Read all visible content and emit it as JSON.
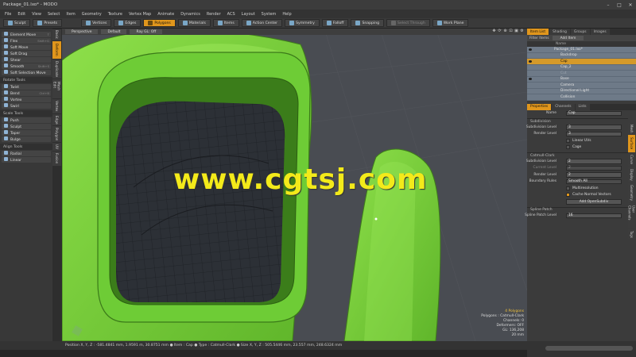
{
  "title": "Package_01.lxo* - MODO",
  "window_controls": [
    "–",
    "□",
    "✕"
  ],
  "menu": [
    "File",
    "Edit",
    "View",
    "Select",
    "Item",
    "Geometry",
    "Texture",
    "Vertex Map",
    "Animate",
    "Dynamics",
    "Render",
    "ACS",
    "Layout",
    "System",
    "Help"
  ],
  "toolbar": {
    "sculpt": "Sculpt",
    "presets": "Presets",
    "vertices": "Vertices",
    "edges": "Edges",
    "polygons": "Polygons",
    "materials": "Materials",
    "items": "Items",
    "action_center": "Action Center",
    "symmetry": "Symmetry",
    "falloff": "Falloff",
    "snapping": "Snapping",
    "select_through": "Select Through",
    "work_plane": "Work Plane"
  },
  "left_panel": {
    "group1": [
      {
        "label": "Element Move",
        "key": "T"
      },
      {
        "label": "Flex",
        "key": "Shift+G"
      },
      {
        "label": "Soft Move",
        "key": ""
      },
      {
        "label": "Soft Drag",
        "key": ""
      },
      {
        "label": "Shear",
        "key": ""
      },
      {
        "label": "Smooth",
        "key": "Shift+S"
      },
      {
        "label": "Soft Selection Move",
        "key": ""
      }
    ],
    "rotate_header": "Rotate Tools",
    "group2": [
      {
        "label": "Twist",
        "key": ""
      },
      {
        "label": "Bend",
        "key": "Ctrl+B"
      },
      {
        "label": "Vortex",
        "key": ""
      },
      {
        "label": "Swirl",
        "key": ""
      }
    ],
    "scale_header": "Scale Tools",
    "group3": [
      {
        "label": "Push",
        "key": ""
      },
      {
        "label": "Sculpt",
        "key": ""
      },
      {
        "label": "Taper",
        "key": ""
      },
      {
        "label": "Bulge",
        "key": ""
      }
    ],
    "align_header": "Align Tools",
    "group4": [
      {
        "label": "Radial",
        "key": ""
      },
      {
        "label": "Linear",
        "key": ""
      }
    ]
  },
  "vertical_tabs": [
    "Basic",
    "Deform",
    "Duplicate",
    "Mesh Edit",
    "Vertex",
    "Edge",
    "Polygon",
    "UV",
    "Fusion"
  ],
  "viewport": {
    "view_mode": "Perspective",
    "shading": "Default",
    "ray_gl": "Ray GL: Off",
    "watermark": "www.cgtsj.com",
    "info": [
      {
        "text": "4 Polygons",
        "highlight": true
      },
      {
        "text": "Polygons : Catmull-Clark",
        "highlight": false
      },
      {
        "text": "Channels: 0",
        "highlight": false
      },
      {
        "text": "Deformers: OFF",
        "highlight": false
      },
      {
        "text": "GL: 136,208",
        "highlight": false
      },
      {
        "text": "20 mm",
        "highlight": false
      }
    ]
  },
  "status": "Position X, Y, Z : -581.4841 mm, 1.9591 m, 30.8751 mm ● Item : Cap ● Type : Catmull-Clark ● Size X, Y, Z : 505.5446 mm, 23.557 mm, 248.6324 mm",
  "right_panel": {
    "top_tabs": [
      "Item List",
      "Shading",
      "Groups",
      "Images"
    ],
    "filter_label": "Filter Items",
    "add_item": "Add Item",
    "name_col": "Name",
    "items": [
      {
        "label": "Package_01.lxo*",
        "indent": 0,
        "selected": false
      },
      {
        "label": "Backdrop",
        "indent": 1,
        "selected": false
      },
      {
        "label": "Cap",
        "indent": 1,
        "selected": true
      },
      {
        "label": "Cap_2",
        "indent": 1,
        "selected": false
      },
      {
        "label": "Cut",
        "indent": 1,
        "selected": false
      },
      {
        "label": "Base",
        "indent": 1,
        "selected": false
      },
      {
        "label": "Camera",
        "indent": 1,
        "selected": false
      },
      {
        "label": "Directional Light",
        "indent": 1,
        "selected": false
      },
      {
        "label": "Collision",
        "indent": 1,
        "selected": false
      }
    ],
    "prop_tabs": [
      "Properties",
      "Channels",
      "Lists"
    ],
    "name_label": "Name",
    "name_value": "Cap",
    "subdivision_header": "Subdivision",
    "subdivision_level_label": "Subdivision Level",
    "subdivision_level": "3",
    "render_level_label": "Render Level",
    "render_level": "3",
    "linear_uvs": "Linear UVs",
    "cage": "Cage",
    "catmull_header": "Catmull-Clark",
    "cc_subdivision_label": "Subdivision Level",
    "cc_subdivision": "2",
    "current_level_label": "Current Level",
    "current_level": "2",
    "cc_render_label": "Render Level",
    "cc_render": "2",
    "boundary_label": "Boundary Rules",
    "boundary_value": "Smooth All",
    "multiresolution": "Multiresolution",
    "cache_normal": "Cache Normal Vectors",
    "add_opensubdiv": "Add OpenSubdiv",
    "spline_header": "Spline Patch",
    "spline_level_label": "Spline Patch Level",
    "spline_level": "16",
    "right_vtabs": [
      "Mesh",
      "Surface",
      "Curve",
      "Display",
      "Geometry",
      "User Channels",
      "Tags"
    ]
  },
  "colors": {
    "accent": "#e0961c",
    "mesh_green": "#7dd33a",
    "watermark": "#f3ea1a"
  }
}
